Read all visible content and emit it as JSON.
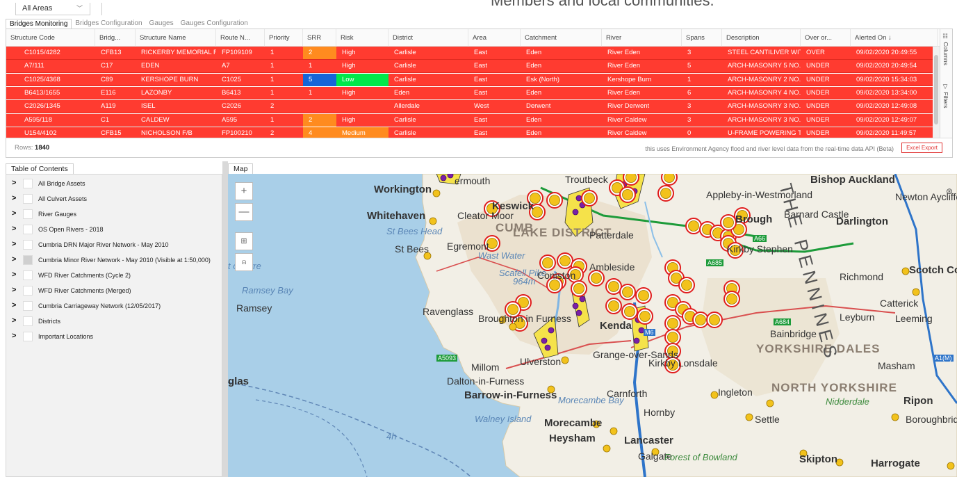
{
  "header": {
    "area_select": "All Areas",
    "hero_text": "Members and local communities."
  },
  "tabs": [
    "Bridges Monitoring",
    "Bridges Configuration",
    "Gauges",
    "Gauges Configuration"
  ],
  "grid": {
    "columns": [
      "Structure Code",
      "Bridg...",
      "Structure Name",
      "Route N...",
      "Priority",
      "SRR",
      "Risk",
      "District",
      "Area",
      "Catchment",
      "River",
      "Spans",
      "Description",
      "Over or...",
      "Alerted On ↓"
    ],
    "rows": [
      [
        "C1015/4282",
        "CFB13",
        "RICKERBY MEMORIAL F/B",
        "FP109109",
        "1",
        "2",
        "High",
        "Carlisle",
        "East",
        "Eden",
        "River Eden",
        "3",
        "STEEL CANTILIVER WITH...",
        "OVER",
        "09/02/2020 20:49:55"
      ],
      [
        "A7/111",
        "C17",
        "EDEN",
        "A7",
        "1",
        "1",
        "High",
        "Carlisle",
        "East",
        "Eden",
        "River Eden",
        "5",
        "ARCH-MASONRY 5 NO...",
        "UNDER",
        "09/02/2020 20:49:54"
      ],
      [
        "C1025/4368",
        "C89",
        "KERSHOPE BURN",
        "C1025",
        "1",
        "5",
        "Low",
        "Carlisle",
        "East",
        "Esk (North)",
        "Kershope Burn",
        "1",
        "ARCH-MASONRY 2 NO...",
        "UNDER",
        "09/02/2020 15:34:03"
      ],
      [
        "B6413/1655",
        "E116",
        "LAZONBY",
        "B6413",
        "1",
        "1",
        "High",
        "Eden",
        "East",
        "Eden",
        "River Eden",
        "6",
        "ARCH-MASONRY 4 NO...",
        "UNDER",
        "09/02/2020 13:34:00"
      ],
      [
        "C2026/1345",
        "A119",
        "ISEL",
        "C2026",
        "2",
        "",
        "",
        "Allerdale",
        "West",
        "Derwent",
        "River Derwent",
        "3",
        "ARCH-MASONRY 3 NO...",
        "UNDER",
        "09/02/2020 12:49:08"
      ],
      [
        "A595/118",
        "C1",
        "CALDEW",
        "A595",
        "1",
        "2",
        "High",
        "Carlisle",
        "East",
        "Eden",
        "River Caldew",
        "3",
        "ARCH-MASONRY 3 NO...",
        "UNDER",
        "09/02/2020 12:49:07"
      ],
      [
        "U154/4102",
        "CFB15",
        "NICHOLSON F/B",
        "FP100210",
        "2",
        "4",
        "Medium",
        "Carlisle",
        "East",
        "Eden",
        "River Caldew",
        "0",
        "U-FRAME POWERING T...",
        "UNDER",
        "09/02/2020 11:49:57"
      ]
    ],
    "side_tools": [
      "Columns",
      "Filters"
    ],
    "rows_label": "Rows:",
    "rows_count": "1840",
    "api_note": "this uses Environment Agency flood and river level data from the real-time data API (Beta)",
    "excel_button": "Excel Export"
  },
  "toc": {
    "title": "Table of Contents",
    "items": [
      "All Bridge Assets",
      "All Culvert Assets",
      "River Gauges",
      "OS Open Rivers - 2018",
      "Cumbria DRN Major River Network - May 2010",
      "Cumbria Minor River Network - May 2010 (Visible at 1:50,000)",
      "WFD River Catchments (Cycle 2)",
      "WFD River Catchments (Merged)",
      "Cumbria Carriageway Network (12/05/2017)",
      "Districts",
      "Important Locations"
    ]
  },
  "map": {
    "title": "Map",
    "zoom_in": "+",
    "zoom_out": "—",
    "labels": {
      "workington": "Workington",
      "whitehaven": "Whitehaven",
      "cockermouth": "ermouth",
      "keswick": "Keswick",
      "troutbeck": "Troutbeck",
      "cleator_moor": "Cleator Moor",
      "st_bees_head": "St Bees Head",
      "st_bees": "St Bees",
      "egremont": "Egremont",
      "wast_water": "Wast Water",
      "lake_district": "LAKE DISTRICT",
      "cumbria": "CUMB",
      "patterdale": "Patterdale",
      "scafell": "Scafell Pike",
      "scafell_height": "964m",
      "ambleside": "Ambleside",
      "coniston": "Coniston",
      "ravenglass": "Ravenglass",
      "broughton": "Broughton in Furness",
      "kendal": "Kenda",
      "grange": "Grange-over-Sands",
      "millom": "Millom",
      "ulverston": "Ulverston",
      "dalton": "Dalton-in-Furness",
      "barrow": "Barrow-in-Furness",
      "walney": "Walney Island",
      "morecambe_bay": "Morecambe Bay",
      "morecambe": "Morecambe",
      "heysham": "Heysham",
      "lancaster": "Lancaster",
      "galgate": "Galgate",
      "forest_bowland": "Forest of Bowland",
      "carnforth": "Carnforth",
      "hornby": "Hornby",
      "ingleton": "Ingleton",
      "kirkby_lonsdale": "Kirkby Lonsdale",
      "appleby": "Appleby-in-Westmorland",
      "brough": "Brough",
      "kirkby_stephen": "Kirkby Stephen",
      "barnard_castle": "Barnard Castle",
      "darlington": "Darlington",
      "bishop_auckland": "Bishop Auckland",
      "newton_aycliffe": "Newton Aycliffe",
      "richmond": "Richmond",
      "scotch_corner": "Scotch Corner",
      "catterick": "Catterick",
      "leyburn": "Leyburn",
      "leeming": "Leeming",
      "bainbridge": "Bainbridge",
      "yorkshire_dales": "YORKSHIRE DALES",
      "masham": "Masham",
      "north_yorkshire": "NORTH YORKSHIRE",
      "nidderdale": "Nidderdale",
      "ripon": "Ripon",
      "boroughbridge": "Boroughbrid",
      "settle": "Settle",
      "skipton": "Skipton",
      "harrogate": "Harrogate",
      "ramsey_bay": "Ramsey Bay",
      "ramsey": "Ramsey",
      "point_of_ayre": "t of Ayre",
      "douglas": "glas",
      "pennines": "THE PENNINES",
      "ferry": "4h",
      "a66": "A66",
      "a5093": "A5093",
      "m6": "M6",
      "a684": "A684",
      "a685": "A685",
      "a1m": "A1(M)"
    }
  },
  "colors": {
    "row_alert": "#ff3b30",
    "srr_orange": "#ff8b1f",
    "srr_blue": "#1565d8",
    "risk_green": "#00e84a",
    "marker_fill": "#f2c21c",
    "marker_ring": "#e01c1c",
    "gauge_purple": "#7a1fa6",
    "sea": "#a9cfe8",
    "land": "#f2efe6",
    "park": "#e8dcc4"
  }
}
